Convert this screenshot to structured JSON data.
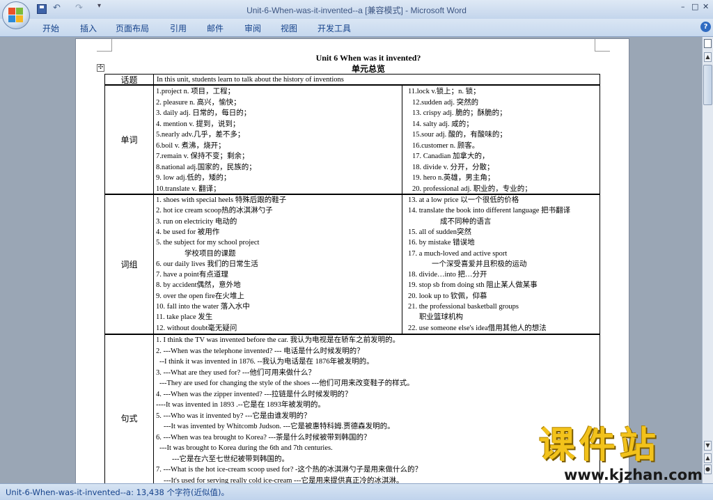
{
  "window": {
    "title": "Unit-6-When-was-it-invented--a [兼容模式] - ",
    "app": "Microsoft Word",
    "qat_undo": "↶",
    "qat_redo": "↷",
    "qat_more": "▾",
    "min": "–",
    "max": "□",
    "close": "✕"
  },
  "ribbon": {
    "tabs": [
      "开始",
      "插入",
      "页面布局",
      "引用",
      "邮件",
      "审阅",
      "视图",
      "开发工具"
    ],
    "help": "?"
  },
  "document": {
    "title": "Unit 6 When was it invented?",
    "subtitle": "单元总览",
    "topic": {
      "label": "话题",
      "text": "In this unit, students learn to talk about the history of inventions"
    },
    "vocabulary": {
      "label": "单词",
      "left": [
        "1.project n. 项目，工程；",
        "2. pleasure n. 高兴，愉快；",
        "3. daily adj. 日常的，每日的；",
        "4. mention v. 提到，说到；",
        "5.nearly adv.几乎，差不多；",
        "6.boil v. 煮沸，烧开；",
        "7.remain v. 保持不变；剩余；",
        "8.national adj.国家的，民族的；",
        "9. low adj.低的，矮的；",
        "10.translate v. 翻译；"
      ],
      "right": [
        "11.lock v.锁上；n. 锁；",
        "12.sudden adj. 突然的",
        "13. crispy adj. 脆的；酥脆的；",
        "14. salty adj. 咸的；",
        "15.sour adj. 酸的，有酸味的；",
        "16.customer n. 顾客。",
        "17. Canadian 加拿大的，",
        "18. divide v. 分开，分散；",
        "19. hero n.英雄，男主角；",
        "20. professional adj. 职业的，专业的；"
      ]
    },
    "phrases": {
      "label": "词组",
      "left": [
        "1. shoes with special heels 特殊后跟的鞋子",
        "2. hot ice cream  scoop热的冰淇淋勺子",
        "3. run on electricity  电动的",
        "4. be used for 被用作",
        "5. the subject for my school project",
        "学校项目的课题",
        "6. our daily lives 我们的日常生活",
        "7. have a point有点道理",
        "8. by accident偶然，意外地",
        "9. over the open fire在火堆上",
        "10. fall into the water 落入水中",
        "11. take place 发生",
        "12. without doubt毫无疑问"
      ],
      "right": [
        "13. at a low price 以一个很低的价格",
        "14. translate the book into different language 把书翻译",
        "成不同种的语言",
        "15. all of sudden突然",
        "16. by mistake 错误地",
        "17. a much-loved  and active  sport",
        "一个深受喜爱并且积极的运动",
        "18. divide…into 把…分开",
        "19. stop sb from doing sth 阻止某人做某事",
        "20. look up to 钦佩，仰慕",
        "21. the professional basketball  groups",
        "职业篮球机构",
        "22. use someone else's idea借用其他人的想法"
      ]
    },
    "patterns": {
      "label": "句式",
      "lines": [
        "1. I think the TV was invented before the car. 我认为电视是在轿车之前发明的。",
        "2. ---When was the telephone  invented?    --- 电话是什么时候发明的？",
        "--I think it was invented in 1876.     --我认为电话是在 1876年被发明的。",
        "3. ---What are they used for?           ---他们可用来做什么？",
        "---They are used for changing the style of the shoes ---他们可用来改变鞋子的样式。",
        "4. ---When was the zipper invented?     ---拉链是什么时候发明的？",
        "----It was invented in 1893          .--它是在 1893年被发明的。",
        "5. ---Who was it invented by?           ---它是由谁发明的？",
        "---It was invented by Whitcomb  Judson.   ---它是被惠特科姆.贾德森发明的。",
        "6. ---When was tea brought to Korea?     ---茶是什么时候被带到韩国的？",
        "---It was brought to Korea during the 6th and 7th centuries.",
        "---它是在六至七世纪被带到韩国的。",
        "7. ---What is the hot ice-cream  scoop used for?   -这个热的冰淇淋勺子是用来做什么的？",
        "---It's used for serving really cold ice-cream    ---它是用来提供真正冷的冰淇淋。"
      ]
    }
  },
  "status": {
    "text": "Unit-6-When-was-it-invented--a: 13,438 个字符(近似值)。"
  },
  "watermark": {
    "main": "课件站",
    "url": "www.kjzhan.com"
  }
}
